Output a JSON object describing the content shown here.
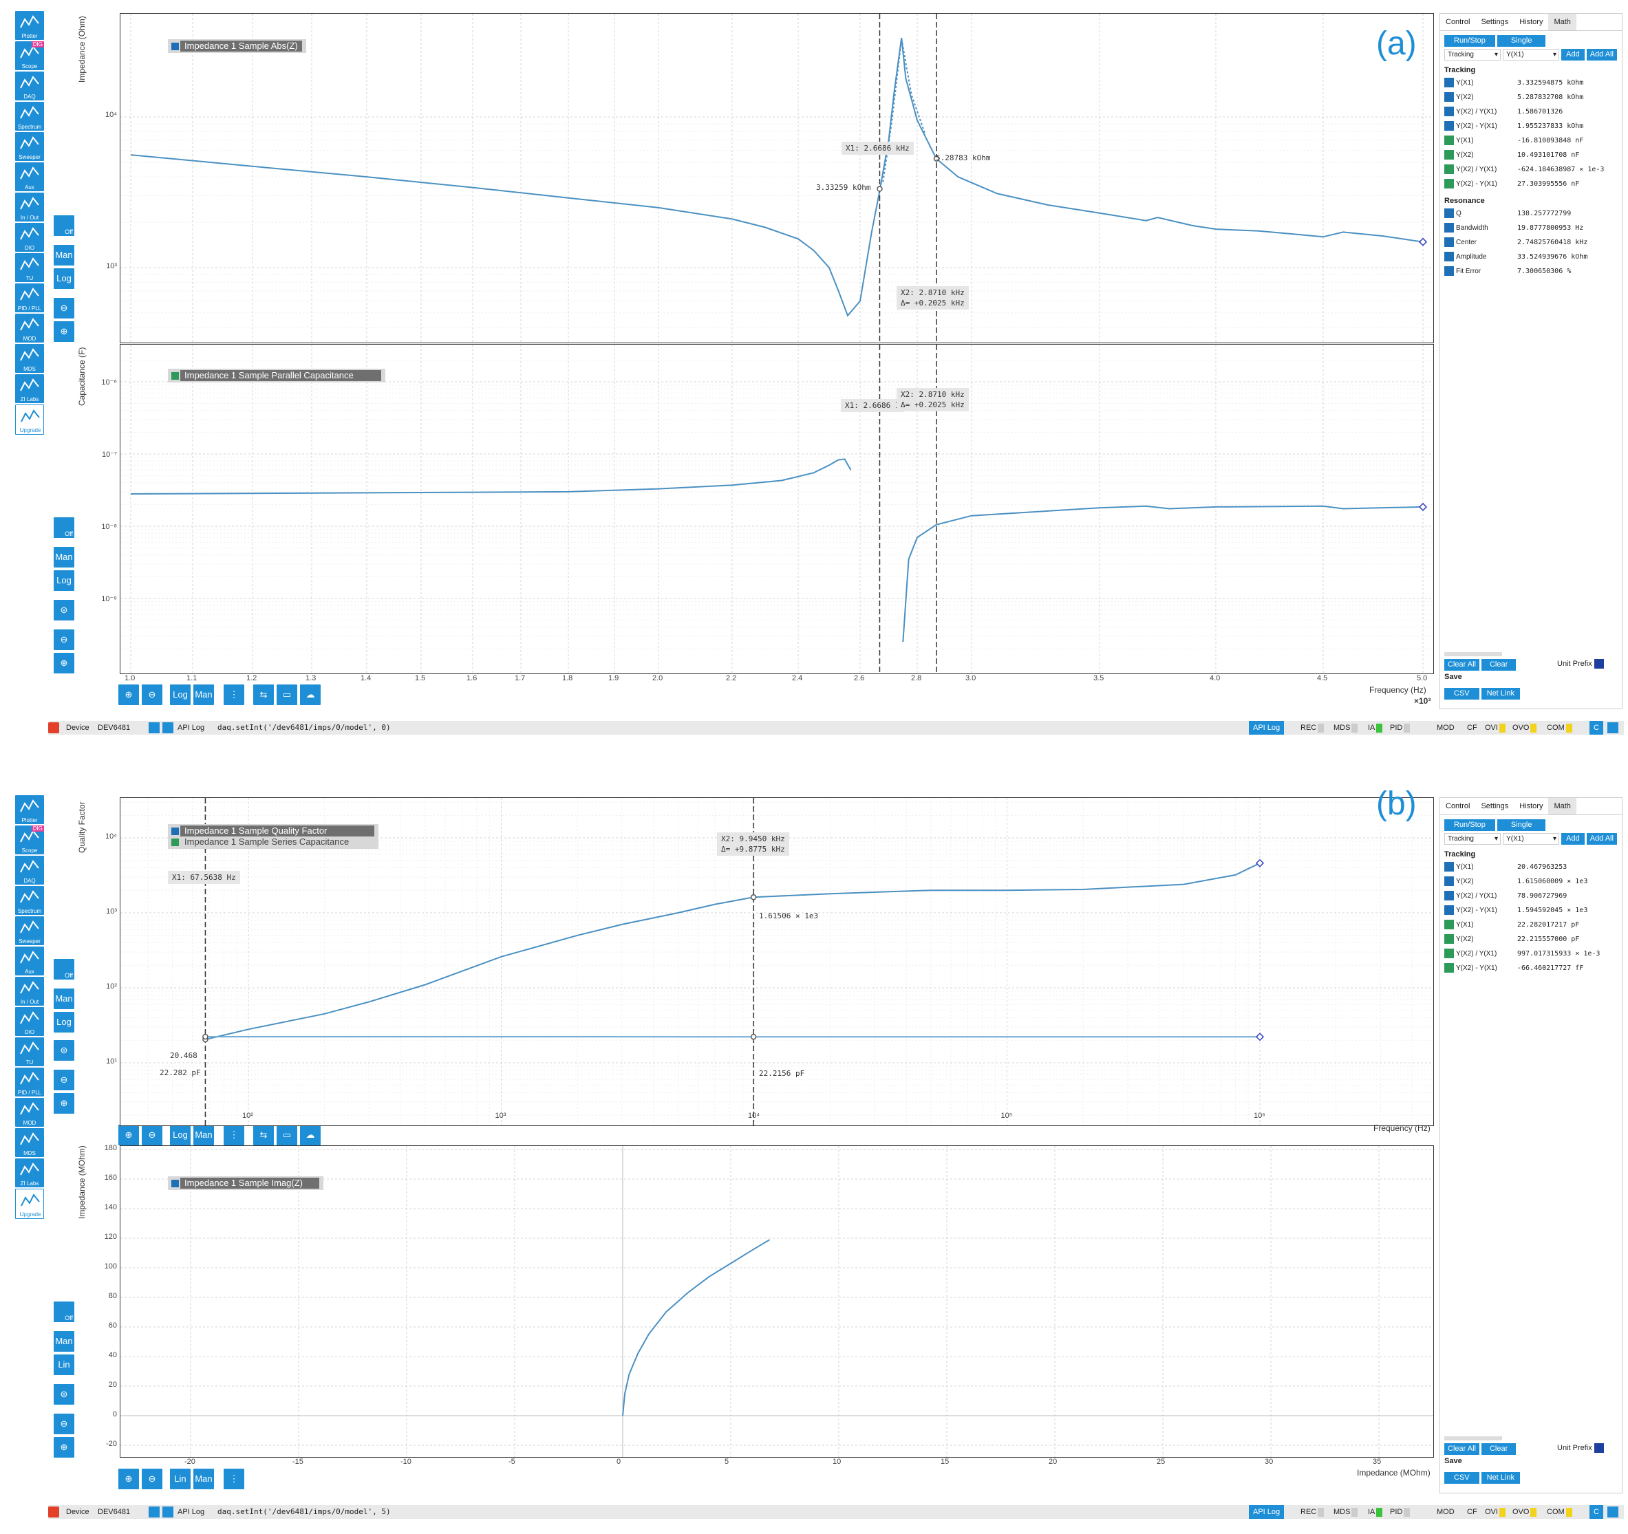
{
  "panel_labels": [
    "(a)",
    "(b)"
  ],
  "sidebar": {
    "items": [
      {
        "icon": "plotter-icon",
        "label": "Plotter"
      },
      {
        "icon": "scope-icon",
        "label": "Scope",
        "badge": "DIG"
      },
      {
        "icon": "daq-icon",
        "label": "DAQ"
      },
      {
        "icon": "spectrum-icon",
        "label": "Spectrum"
      },
      {
        "icon": "sweeper-icon",
        "label": "Sweeper"
      },
      {
        "icon": "aux-icon",
        "label": "Aux"
      },
      {
        "icon": "in-out-icon",
        "label": "In / Out"
      },
      {
        "icon": "dio-icon",
        "label": "DIO"
      },
      {
        "icon": "tu-icon",
        "label": "TU"
      },
      {
        "icon": "pid-pll-icon",
        "label": "PID / PLL"
      },
      {
        "icon": "mod-icon",
        "label": "MOD"
      },
      {
        "icon": "mds-icon",
        "label": "MDS"
      },
      {
        "icon": "zi-labs-icon",
        "label": "ZI Labs"
      },
      {
        "icon": "upgrade-icon",
        "label": "Upgrade"
      }
    ]
  },
  "toolbar": {
    "man": "Man",
    "log": "Log",
    "lin": "Lin",
    "off": "Off"
  },
  "panelA": {
    "top_plot": {
      "ylabel": "Impedance (Ohm)",
      "legend": "Impedance 1 Sample Abs(Z)",
      "yticks": [
        "10⁴",
        "10³"
      ],
      "x1_label": "X1: 2.6686 kHz",
      "x2_label": "X2: 2.8710 kHz",
      "delta_label": "Δ= +0.2025 kHz",
      "x1_value": "3.33259 kOhm",
      "x2_value": "5.28783 kOhm"
    },
    "bottom_plot": {
      "ylabel": "Capacitance (F)",
      "legend": "Impedance 1 Sample Parallel Capacitance",
      "yticks": [
        "10⁻⁶",
        "10⁻⁷",
        "10⁻⁸",
        "10⁻⁹"
      ],
      "x1_label": "X1: 2.6686 I",
      "x2_label": "X2: 2.8710 kHz",
      "delta_label": "Δ= +0.2025 kHz"
    },
    "xticks": [
      "1.0",
      "1.1",
      "1.2",
      "1.3",
      "1.4",
      "1.5",
      "1.6",
      "1.7",
      "1.8",
      "1.9",
      "2.0",
      "2.2",
      "2.4",
      "2.6",
      "2.8",
      "3.0",
      "3.5",
      "4.0",
      "4.5",
      "5.0"
    ],
    "xlabel": "Frequency (Hz)",
    "xscale": "×10³",
    "right_panel": {
      "tabs": [
        "Control",
        "Settings",
        "History",
        "Math"
      ],
      "run_stop": "Run/Stop",
      "single": "Single",
      "select1": "Tracking",
      "select2": "Y(X1)",
      "add": "Add",
      "add_all": "Add All",
      "tracking_title": "Tracking",
      "tracking": [
        {
          "label": "Y(X1)",
          "value": "3.332594875 kOhm",
          "color": "#1e6fb5"
        },
        {
          "label": "Y(X2)",
          "value": "5.287832708 kOhm",
          "color": "#1e6fb5"
        },
        {
          "label": "Y(X2) / Y(X1)",
          "value": "1.586701326",
          "color": "#1e6fb5"
        },
        {
          "label": "Y(X2) - Y(X1)",
          "value": "1.955237833 kOhm",
          "color": "#1e6fb5"
        },
        {
          "label": "Y(X1)",
          "value": "-16.810893848 nF",
          "color": "#2d9a5a"
        },
        {
          "label": "Y(X2)",
          "value": "10.493101708 nF",
          "color": "#2d9a5a"
        },
        {
          "label": "Y(X2) / Y(X1)",
          "value": "-624.184638987 × 1e-3",
          "color": "#2d9a5a"
        },
        {
          "label": "Y(X2) - Y(X1)",
          "value": "27.303995556 nF",
          "color": "#2d9a5a"
        }
      ],
      "resonance_title": "Resonance",
      "resonance": [
        {
          "label": "Q",
          "value": "138.257772799"
        },
        {
          "label": "Bandwidth",
          "value": "19.8777800953 Hz"
        },
        {
          "label": "Center",
          "value": "2.74825760418 kHz"
        },
        {
          "label": "Amplitude",
          "value": "33.524939676 kOhm"
        },
        {
          "label": "Fit Error",
          "value": "7.300650306 %"
        }
      ],
      "clear_all": "Clear All",
      "clear": "Clear",
      "unit_prefix": "Unit Prefix",
      "save": "Save",
      "csv": "CSV",
      "net_link": "Net Link"
    },
    "status": {
      "device": "Device",
      "device_id": "DEV6481",
      "api_log": "API Log",
      "command": "daq.setInt('/dev6481/imps/0/model', 0)"
    }
  },
  "panelB": {
    "top_plot": {
      "ylabel": "Quality Factor",
      "legend1": "Impedance 1 Sample Quality Factor",
      "legend2": "Impedance 1 Sample Series Capacitance",
      "yticks": [
        "10⁴",
        "10³",
        "10²",
        "10¹"
      ],
      "xticks": [
        "10²",
        "10³",
        "10⁴",
        "10⁵",
        "10⁶"
      ],
      "xlabel": "Frequency (Hz)",
      "x1_label": "X1: 67.5638 Hz",
      "x2_label": "X2: 9.9450 kHz",
      "delta_label": "Δ= +9.8775 kHz",
      "q_x1": "20.468",
      "c_x1": "22.282 pF",
      "q_x2": "1.61506 × 1e3",
      "c_x2": "22.2156 pF"
    },
    "bottom_plot": {
      "ylabel": "Impedance (MOhm)",
      "legend": "Impedance 1 Sample Imag(Z)",
      "yticks": [
        "180",
        "160",
        "140",
        "120",
        "100",
        "80",
        "60",
        "40",
        "20",
        "0",
        "-20"
      ],
      "xticks": [
        "-20",
        "-15",
        "-10",
        "-5",
        "0",
        "5",
        "10",
        "15",
        "20",
        "25",
        "30",
        "35"
      ],
      "xlabel": "Impedance (MOhm)"
    },
    "right_panel": {
      "tabs": [
        "Control",
        "Settings",
        "History",
        "Math"
      ],
      "run_stop": "Run/Stop",
      "single": "Single",
      "select1": "Tracking",
      "select2": "Y(X1)",
      "add": "Add",
      "add_all": "Add All",
      "tracking_title": "Tracking",
      "tracking": [
        {
          "label": "Y(X1)",
          "value": "20.467963253",
          "color": "#1e6fb5"
        },
        {
          "label": "Y(X2)",
          "value": "1.615060009 × 1e3",
          "color": "#1e6fb5"
        },
        {
          "label": "Y(X2) / Y(X1)",
          "value": "78.906727969",
          "color": "#1e6fb5"
        },
        {
          "label": "Y(X2) - Y(X1)",
          "value": "1.594592045 × 1e3",
          "color": "#1e6fb5"
        },
        {
          "label": "Y(X1)",
          "value": "22.282017217 pF",
          "color": "#2d9a5a"
        },
        {
          "label": "Y(X2)",
          "value": "22.215557000 pF",
          "color": "#2d9a5a"
        },
        {
          "label": "Y(X2) / Y(X1)",
          "value": "997.017315933 × 1e-3",
          "color": "#2d9a5a"
        },
        {
          "label": "Y(X2) - Y(X1)",
          "value": "-66.460217727 fF",
          "color": "#2d9a5a"
        }
      ],
      "clear_all": "Clear All",
      "clear": "Clear",
      "unit_prefix": "Unit Prefix",
      "save": "Save",
      "csv": "CSV",
      "net_link": "Net Link"
    },
    "status": {
      "device": "Device",
      "device_id": "DEV6481",
      "api_log": "API Log",
      "command": "daq.setInt('/dev6481/imps/0/model', 5)"
    }
  },
  "status_common": {
    "api_log_btn": "API Log",
    "rec": "REC",
    "mds": "MDS",
    "ia": "IA",
    "pid": "PID",
    "mod": "MOD",
    "cf": "CF",
    "ovi": "OVI",
    "ovo": "OVO",
    "com": "COM",
    "c": "C"
  },
  "colors": {
    "accent": "#1e8fd6",
    "trace": "#4a90c2",
    "trace_green": "#2d9a5a",
    "panel_letter": "#1e8fd6"
  },
  "chart_data": [
    {
      "type": "line",
      "title": "",
      "xlabel": "Frequency (Hz)",
      "ylabel": "Impedance (Ohm)",
      "xscale": "linear, ×10³",
      "yscale": "log",
      "series": [
        {
          "name": "Impedance 1 Sample Abs(Z)",
          "x": [
            1.0,
            1.2,
            1.4,
            1.6,
            1.8,
            2.0,
            2.2,
            2.3,
            2.4,
            2.45,
            2.5,
            2.53,
            2.56,
            2.6,
            2.64,
            2.67,
            2.7,
            2.72,
            2.745,
            2.76,
            2.8,
            2.87,
            2.95,
            3.1,
            3.3,
            3.5,
            3.7,
            3.75,
            3.9,
            4.0,
            4.2,
            4.4,
            4.5,
            4.6,
            4.8,
            5.0
          ],
          "y": [
            5600,
            4700,
            4000,
            3400,
            2900,
            2500,
            2100,
            1850,
            1550,
            1300,
            1000,
            700,
            480,
            600,
            1700,
            3330,
            7000,
            15000,
            33500,
            18000,
            9500,
            5290,
            4000,
            3100,
            2600,
            2300,
            2050,
            2150,
            1900,
            1800,
            1750,
            1650,
            1600,
            1720,
            1620,
            1480
          ]
        }
      ]
    },
    {
      "type": "line",
      "title": "",
      "xlabel": "Frequency (Hz)",
      "ylabel": "Capacitance (F)",
      "xscale": "linear, ×10³",
      "yscale": "log",
      "series": [
        {
          "name": "Impedance 1 Sample Parallel Capacitance",
          "x": [
            1.0,
            1.4,
            1.8,
            2.0,
            2.2,
            2.35,
            2.45,
            2.5,
            2.53,
            2.55,
            2.57,
            2.75,
            2.77,
            2.8,
            2.87,
            3.0,
            3.5,
            3.7,
            3.8,
            4.0,
            4.5,
            4.6,
            5.0
          ],
          "y": [
            2.8e-08,
            2.9e-08,
            3e-08,
            3.3e-08,
            3.7e-08,
            4.3e-08,
            5.5e-08,
            7e-08,
            8.3e-08,
            8.5e-08,
            6e-08,
            2.5e-10,
            3.5e-09,
            7e-09,
            1.05e-08,
            1.4e-08,
            1.8e-08,
            1.9e-08,
            1.75e-08,
            1.85e-08,
            1.9e-08,
            1.75e-08,
            1.85e-08
          ]
        }
      ]
    },
    {
      "type": "line",
      "title": "",
      "xlabel": "Frequency (Hz)",
      "ylabel": "Quality Factor",
      "xscale": "log",
      "yscale": "log",
      "series": [
        {
          "name": "Impedance 1 Sample Quality Factor",
          "x": [
            67.56,
            100,
            200,
            300,
            500,
            1000,
            2000,
            3000,
            5000,
            7000,
            9945,
            20000,
            50000,
            100000,
            200000,
            500000,
            800000,
            1000000
          ],
          "y": [
            20.47,
            28,
            45,
            65,
            110,
            260,
            500,
            700,
            1000,
            1300,
            1615,
            1800,
            2000,
            2000,
            2050,
            2400,
            3200,
            4600
          ]
        },
        {
          "name": "Impedance 1 Sample Series Capacitance",
          "x": [
            67.56,
            9945,
            1000000
          ],
          "y": [
            22.282,
            22.2156,
            22.2
          ]
        }
      ]
    },
    {
      "type": "line",
      "title": "",
      "xlabel": "Impedance (MOhm)",
      "ylabel": "Impedance (MOhm)",
      "series": [
        {
          "name": "Impedance 1 Sample Imag(Z)",
          "x": [
            0,
            0.1,
            0.3,
            0.7,
            1.2,
            2.0,
            3.0,
            4.0,
            5.0,
            6.0,
            6.8
          ],
          "y": [
            0,
            15,
            28,
            42,
            55,
            70,
            83,
            94,
            103,
            112,
            119
          ]
        }
      ]
    }
  ]
}
